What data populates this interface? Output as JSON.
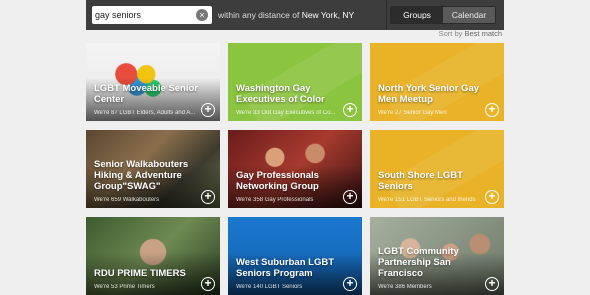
{
  "search": {
    "query": "gay seniors",
    "within_label": "within",
    "distance": "any distance",
    "of_label": "of",
    "location": "New York, NY"
  },
  "view_toggle": {
    "groups_label": "Groups",
    "calendar_label": "Calendar"
  },
  "sort": {
    "label": "Sort by",
    "value": "Best match"
  },
  "groups": [
    {
      "name": "LGBT Moveable Senior Center",
      "members": "We're 87 LGBT Elders, Adults and A...",
      "style": "photo",
      "color": "#8a8a8a"
    },
    {
      "name": "Washington Gay Executives of Color",
      "members": "We're 33 Out Gay Executives of Co...",
      "style": "flat",
      "color": "#8bc43f"
    },
    {
      "name": "North York Senior Gay Men Meetup",
      "members": "We're 27 Senior Gay Men",
      "style": "flat",
      "color": "#e9b227"
    },
    {
      "name": "Senior Walkabouters Hiking & Adventure Group\"SWAG\"",
      "members": "We're 659 Walkabouters",
      "style": "photo",
      "color": "#6b5238"
    },
    {
      "name": "Gay Professionals Networking Group",
      "members": "We're 358 Gay Professionals",
      "style": "photo",
      "color": "#8a2e2a"
    },
    {
      "name": "South Shore LGBT Seniors",
      "members": "We're 151 LGBT Seniors and friends",
      "style": "flat",
      "color": "#e9b227"
    },
    {
      "name": "RDU PRIME TIMERS",
      "members": "We're 53 Prime Timers",
      "style": "photo",
      "color": "#4e6a3c"
    },
    {
      "name": "West Suburban LGBT Seniors Program",
      "members": "We're 140 LGBT Seniors",
      "style": "photo",
      "color": "#1d6fc0"
    },
    {
      "name": "LGBT Community Partnership San Francisco",
      "members": "We're 386 Members",
      "style": "photo",
      "color": "#7d8a78"
    }
  ]
}
